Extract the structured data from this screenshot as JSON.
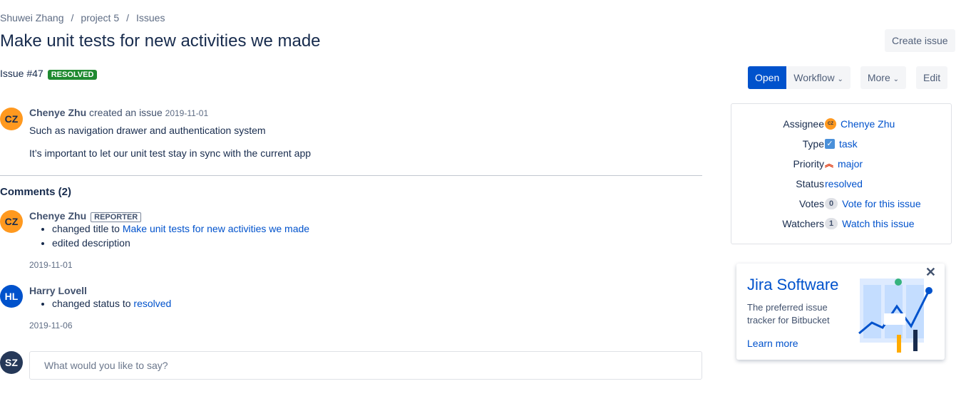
{
  "breadcrumb": [
    "Shuwei Zhang",
    "project 5",
    "Issues"
  ],
  "title": "Make unit tests for new activities we made",
  "create_issue": "Create issue",
  "issue_id": "Issue #47",
  "status_badge": "RESOLVED",
  "actions": {
    "open": "Open",
    "workflow": "Workflow",
    "more": "More",
    "edit": "Edit"
  },
  "description": {
    "avatar": "CZ",
    "author": "Chenye Zhu",
    "action": "created an issue",
    "date": "2019-11-01",
    "lines": [
      "Such as navigation drawer and authentication system",
      "It’s important to let our unit test stay in sync with the current app"
    ]
  },
  "comments_heading": "Comments (2)",
  "comments": [
    {
      "avatar": "CZ",
      "author": "Chenye Zhu",
      "badge": "REPORTER",
      "items": [
        {
          "text": "changed title to ",
          "link": "Make unit tests for new activities we made"
        },
        {
          "text": "edited description"
        }
      ],
      "date": "2019-11-01"
    },
    {
      "avatar": "HL",
      "author": "Harry Lovell",
      "items": [
        {
          "text": "changed status to ",
          "link": "resolved"
        }
      ],
      "date": "2019-11-06"
    }
  ],
  "comment_input": {
    "avatar": "SZ",
    "placeholder": "What would you like to say?"
  },
  "details": {
    "assignee": {
      "label": "Assignee",
      "avatar": "CZ",
      "value": "Chenye Zhu"
    },
    "type": {
      "label": "Type",
      "value": "task"
    },
    "priority": {
      "label": "Priority",
      "value": "major"
    },
    "status": {
      "label": "Status",
      "value": "resolved"
    },
    "votes": {
      "label": "Votes",
      "count": "0",
      "link": "Vote for this issue"
    },
    "watchers": {
      "label": "Watchers",
      "count": "1",
      "link": "Watch this issue"
    }
  },
  "promo": {
    "title": "Jira Software",
    "text_1": "The preferred issue",
    "text_2": "tracker for Bitbucket",
    "link": "Learn more"
  }
}
